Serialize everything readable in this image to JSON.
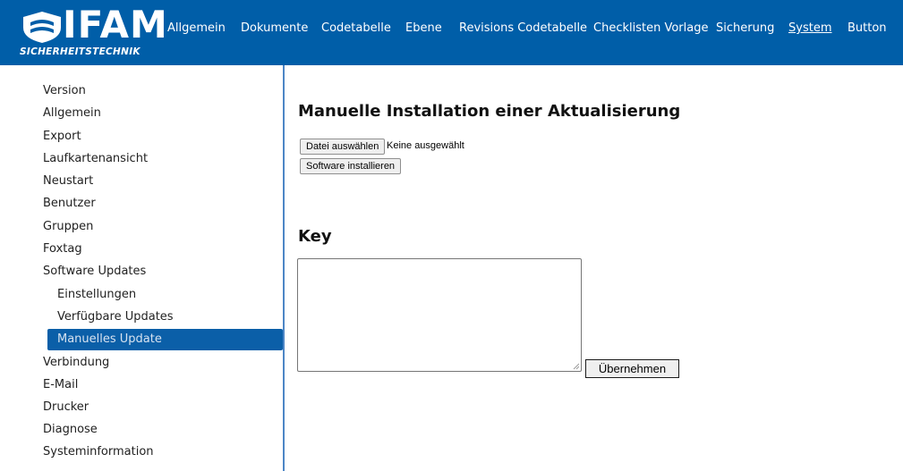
{
  "header": {
    "logo_text": "IFAM",
    "logo_subtitle": "SICHERHEITSTECHNIK",
    "nav": [
      {
        "label": "Allgemein",
        "active": false
      },
      {
        "label": "Dokumente",
        "active": false
      },
      {
        "label": "Codetabelle",
        "active": false
      },
      {
        "label": "Ebene",
        "active": false
      },
      {
        "label": "Revisions Codetabelle",
        "active": false
      },
      {
        "label": "Checklisten Vorlage",
        "active": false
      },
      {
        "label": "Sicherung",
        "active": false
      },
      {
        "label": "System",
        "active": true
      },
      {
        "label": "Button",
        "active": false
      }
    ]
  },
  "sidebar": {
    "items": [
      {
        "label": "Version"
      },
      {
        "label": "Allgemein"
      },
      {
        "label": "Export"
      },
      {
        "label": "Laufkartenansicht"
      },
      {
        "label": "Neustart"
      },
      {
        "label": "Benutzer"
      },
      {
        "label": "Gruppen"
      },
      {
        "label": "Foxtag"
      },
      {
        "label": "Software Updates"
      },
      {
        "label": "Einstellungen",
        "sub": true
      },
      {
        "label": "Verfügbare Updates",
        "sub": true
      },
      {
        "label": "Manuelles Update",
        "sub": true,
        "selected": true
      },
      {
        "label": "Verbindung"
      },
      {
        "label": "E-Mail"
      },
      {
        "label": "Drucker"
      },
      {
        "label": "Diagnose"
      },
      {
        "label": "Systeminformation"
      }
    ]
  },
  "main": {
    "title": "Manuelle Installation einer Aktualisierung",
    "file_button_label": "Datei auswählen",
    "file_status": "Keine ausgewählt",
    "install_button_label": "Software installieren",
    "key_title": "Key",
    "key_value": "",
    "apply_button_label": "Übernehmen"
  },
  "colors": {
    "header_bg": "#005ea8",
    "selected_bg": "#0b5fa8",
    "divider": "#4d86c6"
  }
}
